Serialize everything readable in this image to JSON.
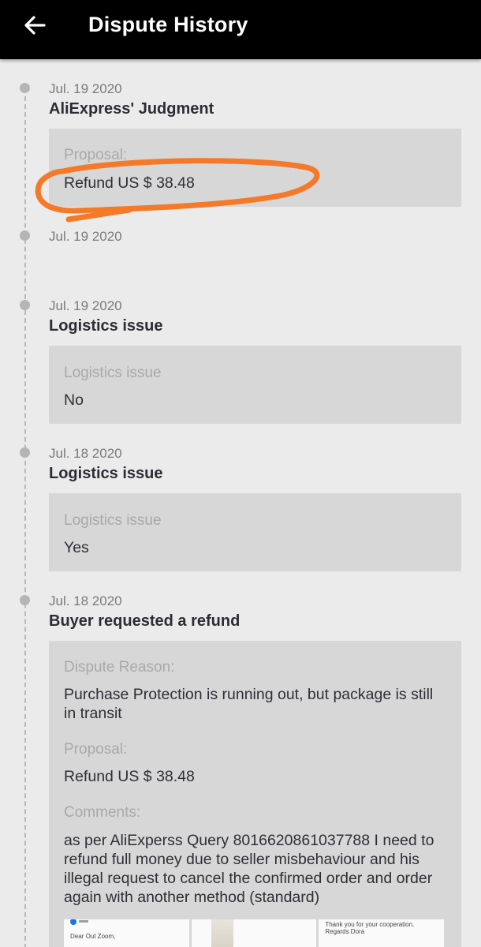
{
  "header": {
    "title": "Dispute History",
    "back_icon": "arrow-left-icon"
  },
  "events": [
    {
      "date": "Jul. 19 2020",
      "title": "AliExpress' Judgment",
      "fields": [
        {
          "label": "Proposal:",
          "value": "Refund US $ 38.48"
        }
      ]
    },
    {
      "date": "Jul. 19 2020",
      "title": "",
      "fields": []
    },
    {
      "date": "Jul. 19 2020",
      "title": "Logistics issue",
      "fields": [
        {
          "label": "Logistics issue",
          "value": "No"
        }
      ]
    },
    {
      "date": "Jul. 18 2020",
      "title": "Logistics issue",
      "fields": [
        {
          "label": "Logistics issue",
          "value": "Yes"
        }
      ]
    },
    {
      "date": "Jul. 18 2020",
      "title": "Buyer requested a refund",
      "fields": [
        {
          "label": "Dispute Reason:",
          "value": "Purchase Protection is running out, but package is still in transit"
        },
        {
          "label": "Proposal:",
          "value": "Refund US $ 38.48"
        },
        {
          "label": "Comments:",
          "value": "as per AliExperss Query 8016620861037788 I need to refund full money due to seller misbehaviour and his illegal request to cancel the confirmed order and order again with another method (standard)"
        }
      ],
      "attachments": [
        {
          "text": "Dear Out Zoom,"
        },
        {
          "text": ""
        },
        {
          "text": "Thank you for your cooperation. Regards Dora"
        }
      ]
    }
  ],
  "annotation": {
    "color": "#f47a2a"
  }
}
